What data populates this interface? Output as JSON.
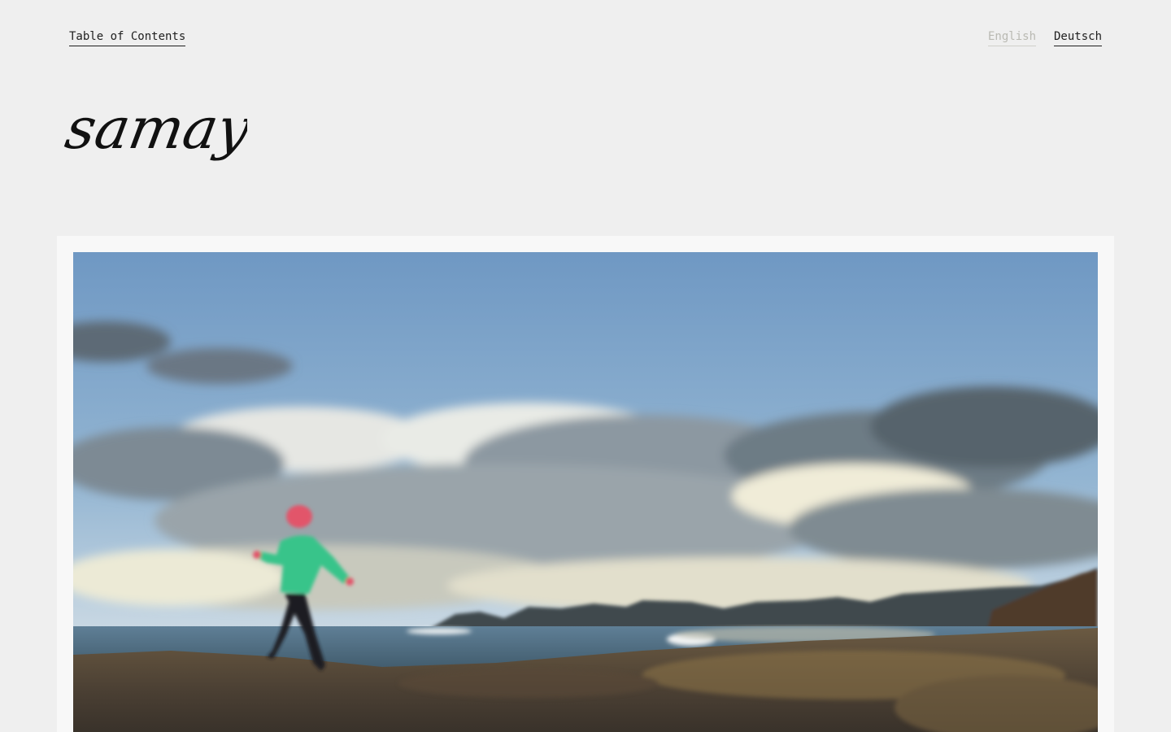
{
  "nav": {
    "toc_label": "Table of Contents",
    "languages": [
      {
        "label": "English",
        "state": "inactive"
      },
      {
        "label": "Deutsch",
        "state": "active"
      }
    ]
  },
  "brand": {
    "logo_text": "samaya"
  },
  "hero": {
    "image_icon": "landscape-photo",
    "colors": {
      "sky_top": "#6f98c3",
      "sky_bottom": "#c9d8e3",
      "sea": "#5f7f96",
      "ground": "#4a3f33",
      "jacket": "#38c48a",
      "beanie": "#e2546a"
    }
  }
}
